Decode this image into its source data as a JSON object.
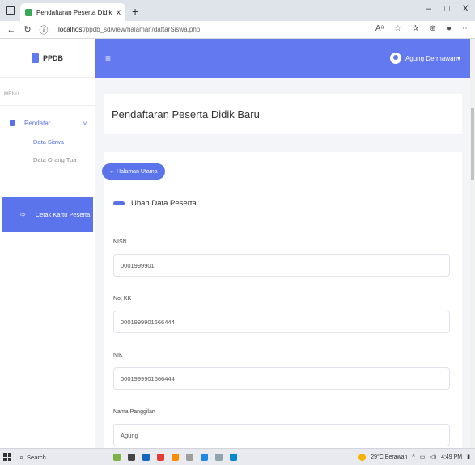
{
  "browser": {
    "tab_title": "Pendaftaran Peserta Didik Baru",
    "tab_close": "x",
    "new_tab": "+",
    "url_host": "localhost",
    "url_path": "/ppdb_sd/view/halaman/daftarSiswa.php",
    "controls": {
      "minimize": "–",
      "restore": "□",
      "close": "X"
    }
  },
  "sidebar": {
    "brand": "PPDB",
    "menu_label": "MENU",
    "menu": {
      "label": "Pendatar",
      "chevron": "v"
    },
    "sub_items": [
      "Data Siswa",
      "Data Orang Tua"
    ],
    "print_button": "Cetak Kartu Peserta"
  },
  "header": {
    "menu_icon": "≡",
    "user_name": "Agung Dermawan"
  },
  "main": {
    "page_title": "Pendaftaran Peserta Didik Baru",
    "home_button": "← Halaman Utama",
    "section_title": "Ubah Data Peserta",
    "fields": [
      {
        "label": "NISN",
        "value": "0001999901"
      },
      {
        "label": "No. KK",
        "value": "0001999901666444"
      },
      {
        "label": "NIK",
        "value": "0001999901666444"
      },
      {
        "label": "Nama Panggilan",
        "value": "Agung"
      }
    ]
  },
  "taskbar": {
    "search_label": "Search",
    "weather": "29°C Berawan",
    "time": "4:49 PM"
  },
  "colors": {
    "primary": "#6379ef",
    "accent": "#5870e8",
    "background": "#f4f5f9"
  }
}
